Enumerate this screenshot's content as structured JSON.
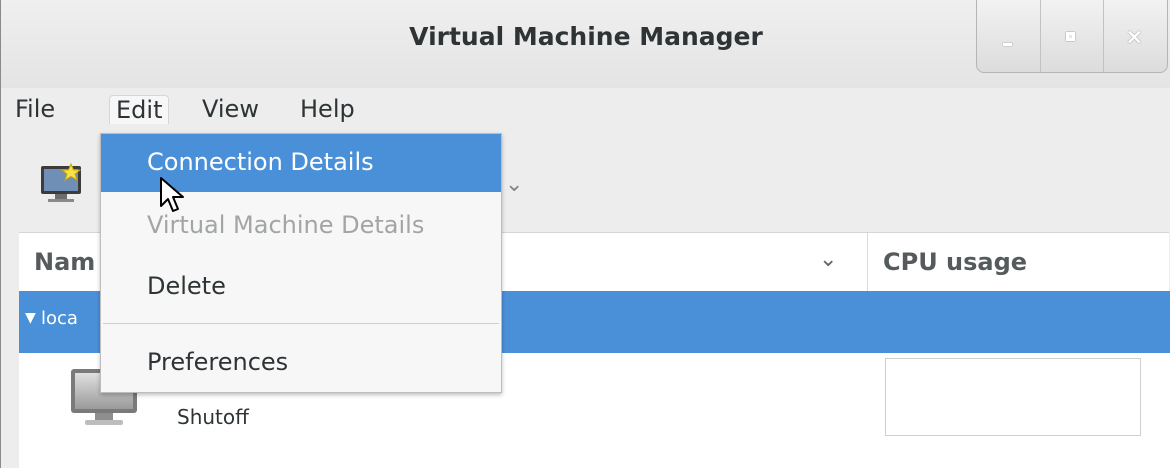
{
  "window": {
    "title": "Virtual Machine Manager",
    "controls": [
      "minimize",
      "maximize",
      "close"
    ],
    "close_glyph": "×"
  },
  "menubar": {
    "items": [
      "File",
      "Edit",
      "View",
      "Help"
    ],
    "active": "Edit"
  },
  "edit_menu": {
    "items": [
      {
        "label": "Connection Details",
        "state": "highlighted"
      },
      {
        "label": "Virtual Machine Details",
        "state": "disabled"
      },
      {
        "label": "Delete",
        "state": "normal"
      },
      {
        "label": "Preferences",
        "state": "normal"
      }
    ]
  },
  "toolbar": {
    "new_vm_icon": "monitor-star-icon",
    "chevron": "⌄"
  },
  "list": {
    "columns": {
      "name": "Nam",
      "cpu": "CPU usage"
    },
    "sort_glyph": "⌄",
    "connection": {
      "label": "loca",
      "expanded": true,
      "arrow": "▼"
    },
    "vm": {
      "state": "Shutoff"
    }
  },
  "colors": {
    "selection": "#4a90d9",
    "window_bg": "#ededed",
    "menu_bg": "#f7f7f7",
    "disabled_text": "#a2a5a6"
  }
}
